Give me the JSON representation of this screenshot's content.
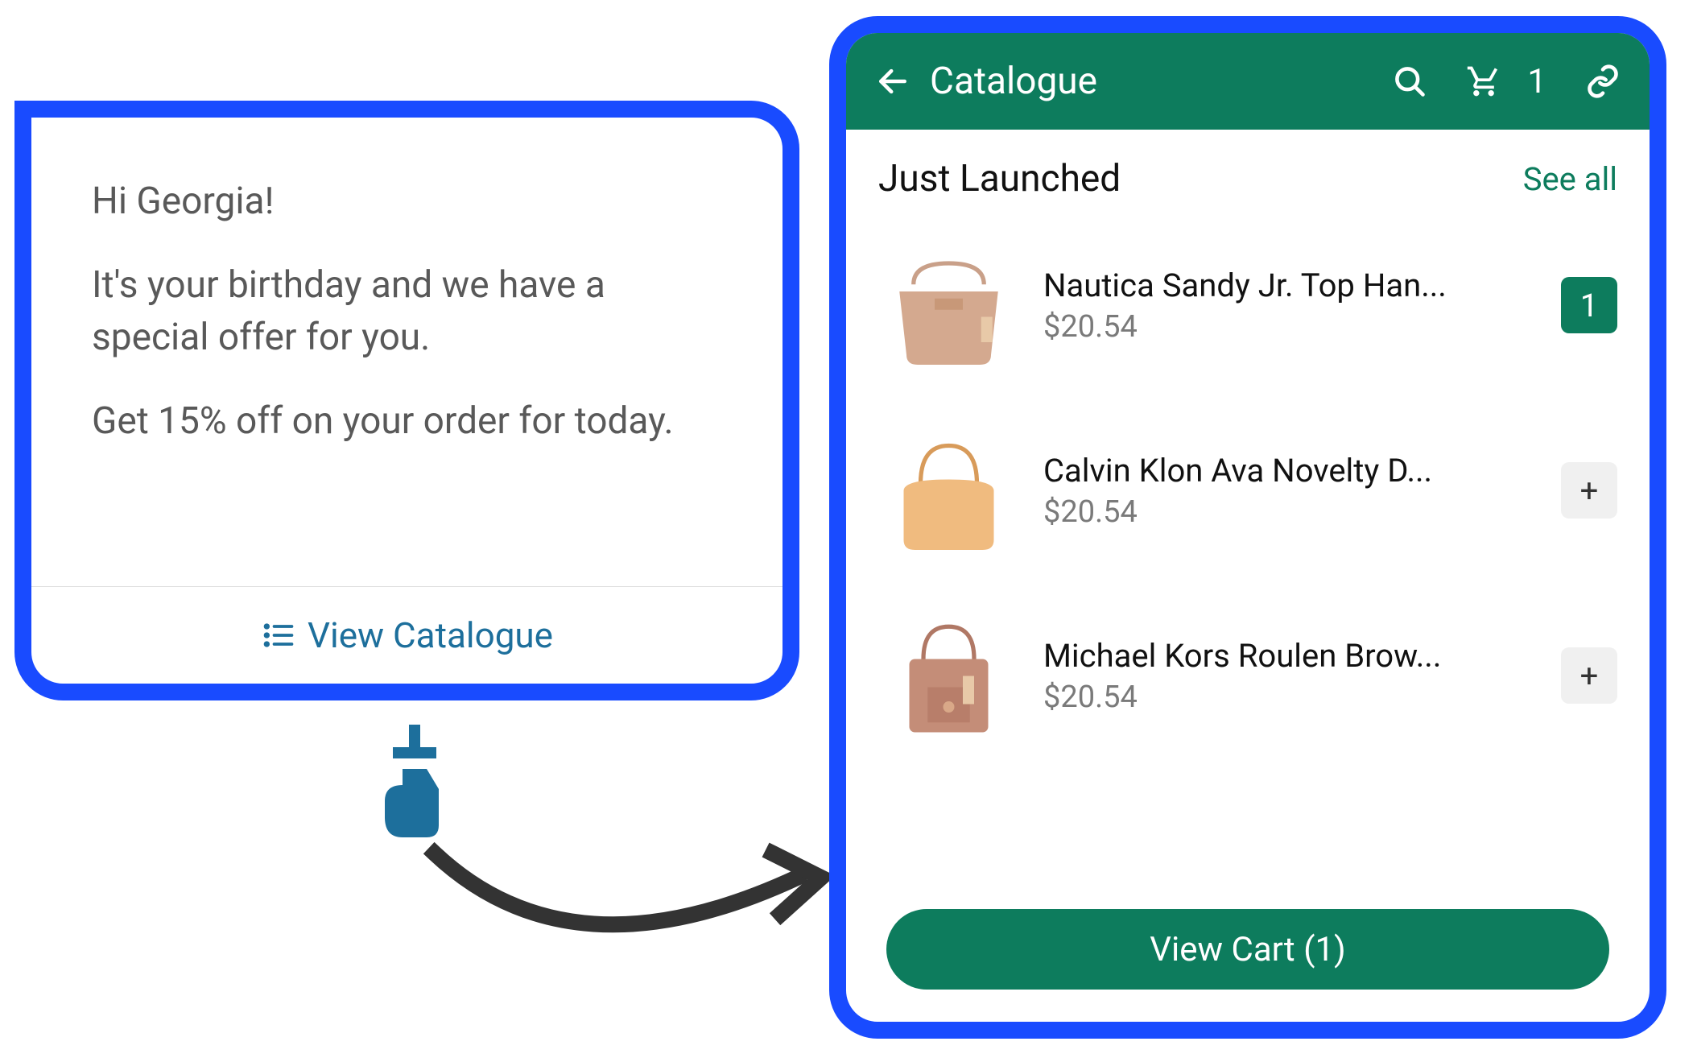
{
  "chat": {
    "greeting": "Hi Georgia!",
    "line1": "It's your birthday and we have a special offer for you.",
    "line2": "Get 15% off on your order for today.",
    "view_catalogue_label": "View Catalogue"
  },
  "catalogue": {
    "header": {
      "title": "Catalogue",
      "cart_count": "1"
    },
    "section_title": "Just Launched",
    "see_all": "See all",
    "products": [
      {
        "name": "Nautica Sandy Jr. Top Han...",
        "price": "$20.54",
        "qty": "1",
        "action": "qty"
      },
      {
        "name": "Calvin Klon Ava Novelty D...",
        "price": "$20.54",
        "action": "add",
        "add_symbol": "+"
      },
      {
        "name": "Michael Kors Roulen Brow...",
        "price": "$20.54",
        "action": "add",
        "add_symbol": "+"
      }
    ],
    "view_cart_label": "View Cart (1)"
  }
}
